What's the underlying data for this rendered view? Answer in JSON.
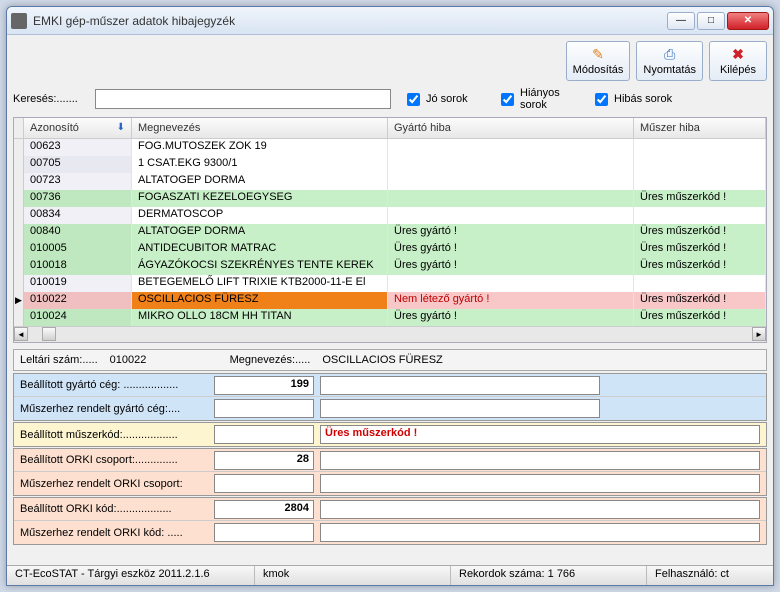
{
  "window": {
    "title": "EMKI gép-műszer adatok hibajegyzék"
  },
  "toolbar": {
    "edit": "Módosítás",
    "print": "Nyomtatás",
    "exit": "Kilépés"
  },
  "search": {
    "label": "Keresés:.......",
    "value": "",
    "chk_good": "Jó sorok",
    "chk_missing": "Hiányos sorok",
    "chk_error": "Hibás sorok"
  },
  "grid": {
    "headers": {
      "id": "Azonosító",
      "name": "Megnevezés",
      "mfr_err": "Gyártó hiba",
      "instr_err": "Műszer hiba"
    },
    "rows": [
      {
        "id": "00623",
        "name": "FOG.MUTOSZEK ZOK 19",
        "mfr": "",
        "instr": "",
        "cls": ""
      },
      {
        "id": "00705",
        "name": "1 CSAT.EKG 9300/1",
        "mfr": "",
        "instr": "",
        "cls": "alt"
      },
      {
        "id": "00723",
        "name": "ALTATOGEP DORMA",
        "mfr": "",
        "instr": "",
        "cls": ""
      },
      {
        "id": "00736",
        "name": "FOGASZATI KEZELOEGYSEG",
        "mfr": "",
        "instr": "Üres műszerkód !",
        "cls": "green"
      },
      {
        "id": "00834",
        "name": "DERMATOSCOP",
        "mfr": "",
        "instr": "",
        "cls": ""
      },
      {
        "id": "00840",
        "name": "ALTATOGEP DORMA",
        "mfr": "Üres gyártó !",
        "instr": "Üres műszerkód !",
        "cls": "green"
      },
      {
        "id": "010005",
        "name": "ANTIDECUBITOR MATRAC",
        "mfr": "Üres gyártó !",
        "instr": "Üres műszerkód !",
        "cls": "green"
      },
      {
        "id": "010018",
        "name": "ÁGYAZÓKOCSI SZEKRÉNYES TENTE KEREK",
        "mfr": "Üres gyártó !",
        "instr": "Üres műszerkód !",
        "cls": "green"
      },
      {
        "id": "010019",
        "name": "BETEGEMELŐ LIFT TRIXIE KTB2000-11-E El",
        "mfr": "",
        "instr": "",
        "cls": ""
      },
      {
        "id": "010022",
        "name": "OSCILLACIOS FÜRESZ",
        "mfr": "Nem létező gyártó !",
        "instr": "Üres műszerkód !",
        "cls": "pink",
        "sel": true,
        "orange_name": true,
        "red_mfr": true
      },
      {
        "id": "010024",
        "name": "MIKRO OLLO 18CM  HH TITAN",
        "mfr": "Üres gyártó !",
        "instr": "Üres műszerkód !",
        "cls": "green"
      }
    ]
  },
  "details": {
    "inv_label": "Leltári szám:.....",
    "inv_value": "010022",
    "name_label": "Megnevezés:.....",
    "name_value": "OSCILLACIOS FÜRESZ",
    "mfr_set_label": "Beállított gyártó cég: ..................",
    "mfr_set_value": "199",
    "mfr_assigned_label": "Műszerhez rendelt gyártó cég:....",
    "instr_code_label": "Beállított műszerkód:..................",
    "instr_code_error": "Üres műszerkód !",
    "orki_group_set_label": "Beállított ORKI csoport:..............",
    "orki_group_set_value": "28",
    "orki_group_assigned_label": "Műszerhez rendelt ORKI csoport:",
    "orki_code_set_label": "Beállított ORKI kód:..................",
    "orki_code_set_value": "2804",
    "orki_code_assigned_label": "Műszerhez rendelt ORKI kód: ....."
  },
  "status": {
    "app": "CT-EcoSTAT - Tárgyi eszköz 2011.2.1.6",
    "user_short": "kmok",
    "records": "Rekordok száma: 1 766",
    "user": "Felhasználó: ct"
  }
}
